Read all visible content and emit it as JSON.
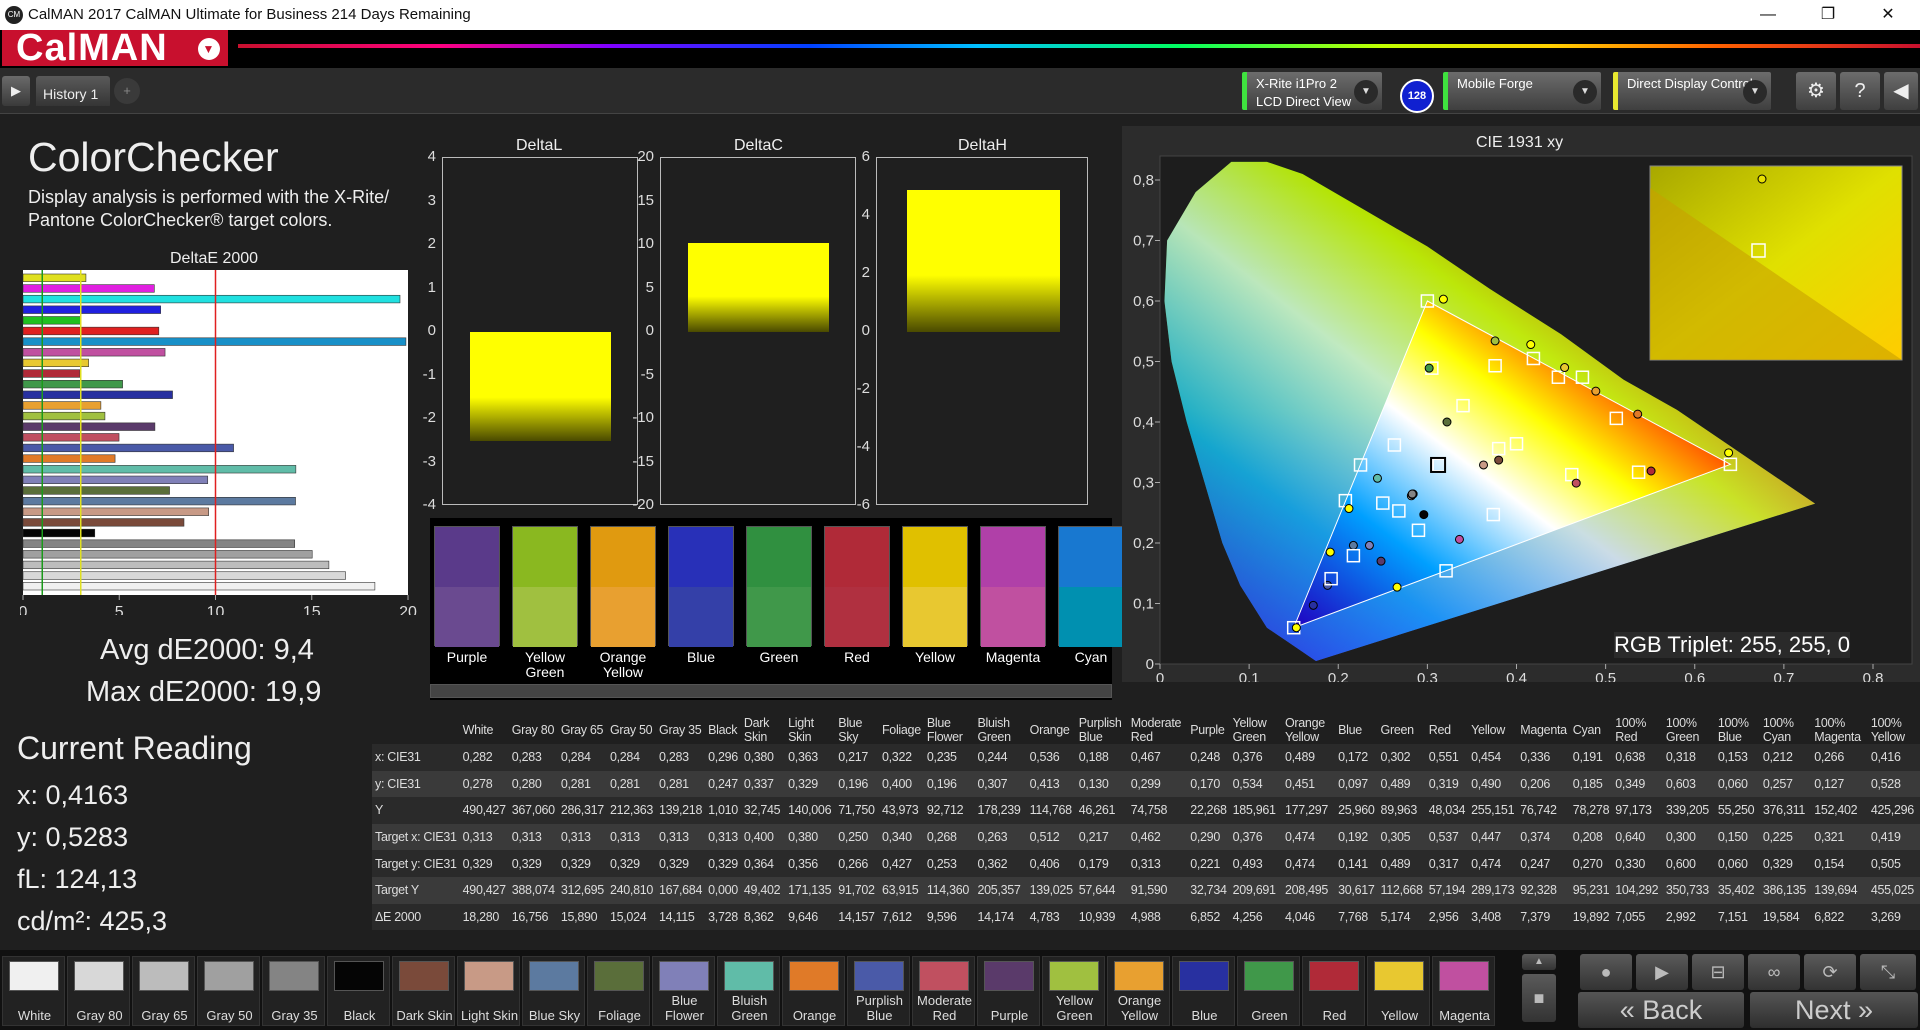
{
  "window": {
    "title": "CalMAN 2017 CalMAN Ultimate for Business 214 Days Remaining",
    "minimize": "—",
    "restore": "❐",
    "close": "✕",
    "app_icon": "CM"
  },
  "brand": {
    "logo": "CalMAN"
  },
  "tabs": {
    "history": "History 1",
    "add": "+"
  },
  "devices": {
    "meter_line1": "X-Rite i1Pro 2",
    "meter_line2": "LCD Direct View",
    "badge": "128",
    "source": "Mobile Forge",
    "display": "Direct Display Control"
  },
  "colorchecker": {
    "title": "ColorChecker",
    "description": "Display analysis is performed with the X-Rite/ Pantone ColorChecker® target colors.",
    "deltae_title": "DeltaE 2000",
    "deltae_ticks": [
      "0",
      "5",
      "10",
      "15",
      "20"
    ],
    "avg": "Avg dE2000: 9,4",
    "max": "Max dE2000: 19,9"
  },
  "current_reading": {
    "title": "Current Reading",
    "x": "x: 0,4163",
    "y": "y: 0,5283",
    "fl": "fL: 124,13",
    "cdm2": "cd/m²: 425,3"
  },
  "delta_charts": [
    {
      "title": "DeltaL",
      "ticks": [
        "4",
        "3",
        "2",
        "1",
        "0",
        "-1",
        "-2",
        "-3",
        "-4"
      ],
      "min": -4,
      "max": 4,
      "value": -2.5
    },
    {
      "title": "DeltaC",
      "ticks": [
        "20",
        "15",
        "10",
        "5",
        "0",
        "-5",
        "-10",
        "-15",
        "-20"
      ],
      "min": -20,
      "max": 20,
      "value": 10.2
    },
    {
      "title": "DeltaH",
      "ticks": [
        "6",
        "4",
        "2",
        "0",
        "-2",
        "-4",
        "-6"
      ],
      "min": -6,
      "max": 6,
      "value": 4.9
    }
  ],
  "swatches": [
    {
      "label": "Purple",
      "top": "#5a3a8a",
      "bot": "#6a4a90"
    },
    {
      "label": "Yellow Green",
      "top": "#8ab820",
      "bot": "#a0c040"
    },
    {
      "label": "Orange Yellow",
      "top": "#e09a10",
      "bot": "#e8a030"
    },
    {
      "label": "Blue",
      "top": "#2830b8",
      "bot": "#3440a8"
    },
    {
      "label": "Green",
      "top": "#309040",
      "bot": "#40984a"
    },
    {
      "label": "Red",
      "top": "#b02a38",
      "bot": "#b03040"
    },
    {
      "label": "Yellow",
      "top": "#e0c000",
      "bot": "#e8c830"
    },
    {
      "label": "Magenta",
      "top": "#b040a8",
      "bot": "#c050a0"
    },
    {
      "label": "Cyan",
      "top": "#1878d0",
      "bot": "#0090b0"
    }
  ],
  "cie": {
    "title": "CIE 1931 xy",
    "xticks": [
      "0",
      "0,1",
      "0,2",
      "0,3",
      "0,4",
      "0,5",
      "0,6",
      "0,7",
      "0,8"
    ],
    "yticks": [
      "0",
      "0,1",
      "0,2",
      "0,3",
      "0,4",
      "0,5",
      "0,6",
      "0,7",
      "0,8"
    ],
    "rgb_triplet": "RGB Triplet: 255, 255, 0"
  },
  "chart_data": {
    "type": "bar",
    "title": "DeltaE 2000",
    "categories": [
      "White",
      "Gray 80",
      "Gray 65",
      "Gray 50",
      "Gray 35",
      "Black",
      "Dark Skin",
      "Light Skin",
      "Blue Sky",
      "Foliage",
      "Blue Flower",
      "Bluish Green",
      "Orange",
      "Purplish Blue",
      "Moderate Red",
      "Purple",
      "Yellow Green",
      "Orange Yellow",
      "Blue",
      "Green",
      "Red",
      "Yellow",
      "Magenta",
      "Cyan",
      "100% Red",
      "100% Green",
      "100% Blue",
      "100% Cyan",
      "100% Magenta",
      "100% Yellow"
    ],
    "values": [
      18.28,
      16.756,
      15.89,
      15.024,
      14.115,
      3.728,
      8.362,
      9.646,
      14.157,
      7.612,
      9.596,
      14.174,
      4.783,
      10.939,
      4.988,
      6.852,
      4.256,
      4.046,
      7.768,
      5.174,
      2.956,
      3.408,
      7.379,
      19.892,
      7.055,
      2.992,
      7.151,
      19.584,
      6.822,
      3.269
    ],
    "xlim": [
      0,
      20
    ]
  },
  "table": {
    "headers": [
      "",
      "White",
      "Gray 80",
      "Gray 65",
      "Gray 50",
      "Gray 35",
      "Black",
      "Dark Skin",
      "Light Skin",
      "Blue Sky",
      "Foliage",
      "Blue Flower",
      "Bluish Green",
      "Orange",
      "Purplish Blue",
      "Moderate Red",
      "Purple",
      "Yellow Green",
      "Orange Yellow",
      "Blue",
      "Green",
      "Red",
      "Yellow",
      "Magenta",
      "Cyan",
      "100% Red",
      "100% Green",
      "100% Blue",
      "100% Cyan",
      "100% Magenta",
      "100% Yellow"
    ],
    "rows": [
      [
        "x: CIE31",
        "0,282",
        "0,283",
        "0,284",
        "0,284",
        "0,283",
        "0,296",
        "0,380",
        "0,363",
        "0,217",
        "0,322",
        "0,235",
        "0,244",
        "0,536",
        "0,188",
        "0,467",
        "0,248",
        "0,376",
        "0,489",
        "0,172",
        "0,302",
        "0,551",
        "0,454",
        "0,336",
        "0,191",
        "0,638",
        "0,318",
        "0,153",
        "0,212",
        "0,266",
        "0,416"
      ],
      [
        "y: CIE31",
        "0,278",
        "0,280",
        "0,281",
        "0,281",
        "0,281",
        "0,247",
        "0,337",
        "0,329",
        "0,196",
        "0,400",
        "0,196",
        "0,307",
        "0,413",
        "0,130",
        "0,299",
        "0,170",
        "0,534",
        "0,451",
        "0,097",
        "0,489",
        "0,319",
        "0,490",
        "0,206",
        "0,185",
        "0,349",
        "0,603",
        "0,060",
        "0,257",
        "0,127",
        "0,528"
      ],
      [
        "Y",
        "490,427",
        "367,060",
        "286,317",
        "212,363",
        "139,218",
        "1,010",
        "32,745",
        "140,006",
        "71,750",
        "43,973",
        "92,712",
        "178,239",
        "114,768",
        "46,261",
        "74,758",
        "22,268",
        "185,961",
        "177,297",
        "25,960",
        "89,963",
        "48,034",
        "255,151",
        "76,742",
        "78,278",
        "97,173",
        "339,205",
        "55,250",
        "376,311",
        "152,402",
        "425,296"
      ],
      [
        "Target x: CIE31",
        "0,313",
        "0,313",
        "0,313",
        "0,313",
        "0,313",
        "0,313",
        "0,400",
        "0,380",
        "0,250",
        "0,340",
        "0,268",
        "0,263",
        "0,512",
        "0,217",
        "0,462",
        "0,290",
        "0,376",
        "0,474",
        "0,192",
        "0,305",
        "0,537",
        "0,447",
        "0,374",
        "0,208",
        "0,640",
        "0,300",
        "0,150",
        "0,225",
        "0,321",
        "0,419"
      ],
      [
        "Target y: CIE31",
        "0,329",
        "0,329",
        "0,329",
        "0,329",
        "0,329",
        "0,329",
        "0,364",
        "0,356",
        "0,266",
        "0,427",
        "0,253",
        "0,362",
        "0,406",
        "0,179",
        "0,313",
        "0,221",
        "0,493",
        "0,474",
        "0,141",
        "0,489",
        "0,317",
        "0,474",
        "0,247",
        "0,270",
        "0,330",
        "0,600",
        "0,060",
        "0,329",
        "0,154",
        "0,505"
      ],
      [
        "Target Y",
        "490,427",
        "388,074",
        "312,695",
        "240,810",
        "167,684",
        "0,000",
        "49,402",
        "171,135",
        "91,702",
        "63,915",
        "114,360",
        "205,357",
        "139,025",
        "57,644",
        "91,590",
        "32,734",
        "209,691",
        "208,495",
        "30,617",
        "112,668",
        "57,194",
        "289,173",
        "92,328",
        "95,231",
        "104,292",
        "350,733",
        "35,402",
        "386,135",
        "139,694",
        "455,025"
      ],
      [
        "ΔE 2000",
        "18,280",
        "16,756",
        "15,890",
        "15,024",
        "14,115",
        "3,728",
        "8,362",
        "9,646",
        "14,157",
        "7,612",
        "9,596",
        "14,174",
        "4,783",
        "10,939",
        "4,988",
        "6,852",
        "4,256",
        "4,046",
        "7,768",
        "5,174",
        "2,956",
        "3,408",
        "7,379",
        "19,892",
        "7,055",
        "2,992",
        "7,151",
        "19,584",
        "6,822",
        "3,269"
      ]
    ]
  },
  "bottom_swatches": [
    {
      "label": "White",
      "color": "#f0f0f0"
    },
    {
      "label": "Gray 80",
      "color": "#d8d8d8"
    },
    {
      "label": "Gray 65",
      "color": "#bcbcbc"
    },
    {
      "label": "Gray 50",
      "color": "#a0a0a0"
    },
    {
      "label": "Gray 35",
      "color": "#848484"
    },
    {
      "label": "Black",
      "color": "#050505"
    },
    {
      "label": "Dark Skin",
      "color": "#7a4a3a"
    },
    {
      "label": "Light Skin",
      "color": "#c89a86"
    },
    {
      "label": "Blue Sky",
      "color": "#5c7aa0"
    },
    {
      "label": "Foliage",
      "color": "#5a6e3a"
    },
    {
      "label": "Blue Flower",
      "color": "#8080b8"
    },
    {
      "label": "Bluish Green",
      "color": "#60bca8"
    },
    {
      "label": "Orange",
      "color": "#e07a28"
    },
    {
      "label": "Purplish Blue",
      "color": "#4a5aa8"
    },
    {
      "label": "Moderate Red",
      "color": "#c05060"
    },
    {
      "label": "Purple",
      "color": "#5a3a6a"
    },
    {
      "label": "Yellow Green",
      "color": "#a0c040"
    },
    {
      "label": "Orange Yellow",
      "color": "#e8a030"
    },
    {
      "label": "Blue",
      "color": "#2830a0"
    },
    {
      "label": "Green",
      "color": "#40984a"
    },
    {
      "label": "Red",
      "color": "#b02a38"
    },
    {
      "label": "Yellow",
      "color": "#e8c830"
    },
    {
      "label": "Magenta",
      "color": "#c050a0"
    }
  ],
  "nav": {
    "back": "Back",
    "next": "Next",
    "back_icon": "«",
    "next_icon": "»"
  }
}
